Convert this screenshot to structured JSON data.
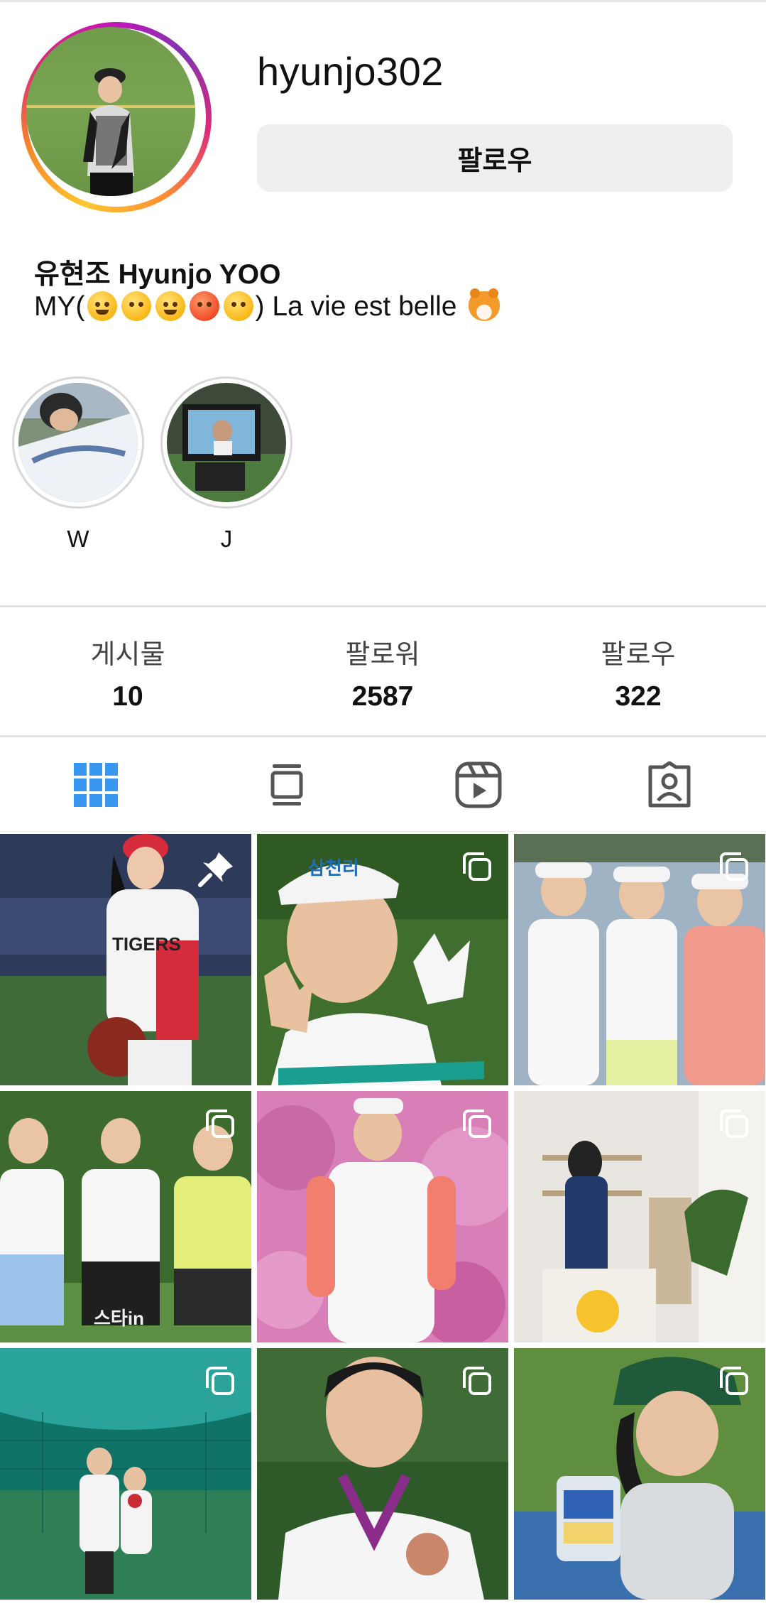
{
  "profile": {
    "username": "hyunjo302",
    "follow_label": "팔로우",
    "display_name": "유현조 Hyunjo YOO",
    "bio_prefix": "MY(",
    "bio_suffix": ") La vie est belle",
    "bio_emojis": [
      "laughing-face",
      "kissing-face",
      "smiling-face",
      "angry-face",
      "confounded-face"
    ],
    "bio_trailing_emoji": "tiger-face"
  },
  "highlights": [
    {
      "label": "W"
    },
    {
      "label": "J"
    }
  ],
  "stats": [
    {
      "label": "게시물",
      "value": "10"
    },
    {
      "label": "팔로워",
      "value": "2587"
    },
    {
      "label": "팔로우",
      "value": "322"
    }
  ],
  "tabs": [
    {
      "icon": "grid-icon",
      "active": true
    },
    {
      "icon": "feed-icon",
      "active": false
    },
    {
      "icon": "reels-icon",
      "active": false
    },
    {
      "icon": "tagged-icon",
      "active": false
    }
  ],
  "colors": {
    "accent": "#3897f0",
    "follow_button_bg": "#efefef",
    "divider": "#e2e2e2"
  },
  "posts": [
    {
      "badge": "pin-icon",
      "overlay_text": "TIGERS"
    },
    {
      "badge": "carousel-icon",
      "overlay_text": "삼천리"
    },
    {
      "badge": "carousel-icon",
      "overlay_text": ""
    },
    {
      "badge": "carousel-icon",
      "overlay_text": "스타in"
    },
    {
      "badge": "carousel-icon",
      "overlay_text": ""
    },
    {
      "badge": "carousel-icon",
      "overlay_text": ""
    },
    {
      "badge": "carousel-icon",
      "overlay_text": ""
    },
    {
      "badge": "carousel-icon",
      "overlay_text": ""
    },
    {
      "badge": "carousel-icon",
      "overlay_text": ""
    }
  ]
}
